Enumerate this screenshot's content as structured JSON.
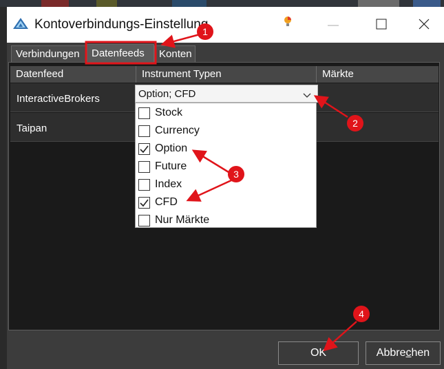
{
  "window": {
    "title": "Kontoverbindungs-Einstellung",
    "icons": {
      "app": "app-triangle-icon",
      "notification": "lightbulb-icon",
      "minimize": "minimize-icon",
      "maximize": "maximize-icon",
      "close": "close-icon"
    }
  },
  "tabs": [
    {
      "label": "Verbindungen",
      "active": false
    },
    {
      "label": "Datenfeeds",
      "active": true
    },
    {
      "label": "Konten",
      "active": false
    }
  ],
  "table": {
    "headers": [
      "Datenfeed",
      "Instrument Typen",
      "Märkte"
    ],
    "rows": [
      {
        "datafeed": "InteractiveBrokers",
        "instrument_types": "Option; CFD"
      },
      {
        "datafeed": "Taipan",
        "instrument_types": ""
      }
    ]
  },
  "dropdown": {
    "value": "Option; CFD",
    "options": [
      {
        "label": "Stock",
        "checked": false
      },
      {
        "label": "Currency",
        "checked": false
      },
      {
        "label": "Option",
        "checked": true
      },
      {
        "label": "Future",
        "checked": false
      },
      {
        "label": "Index",
        "checked": false
      },
      {
        "label": "CFD",
        "checked": true
      },
      {
        "label": "Nur Märkte",
        "checked": false
      }
    ]
  },
  "buttons": {
    "ok": "OK",
    "cancel_pre": "Abbre",
    "cancel_mnemonic": "c",
    "cancel_post": "hen"
  },
  "annotations": {
    "color": "#e0141a",
    "badges": [
      "1",
      "2",
      "3",
      "4"
    ]
  }
}
